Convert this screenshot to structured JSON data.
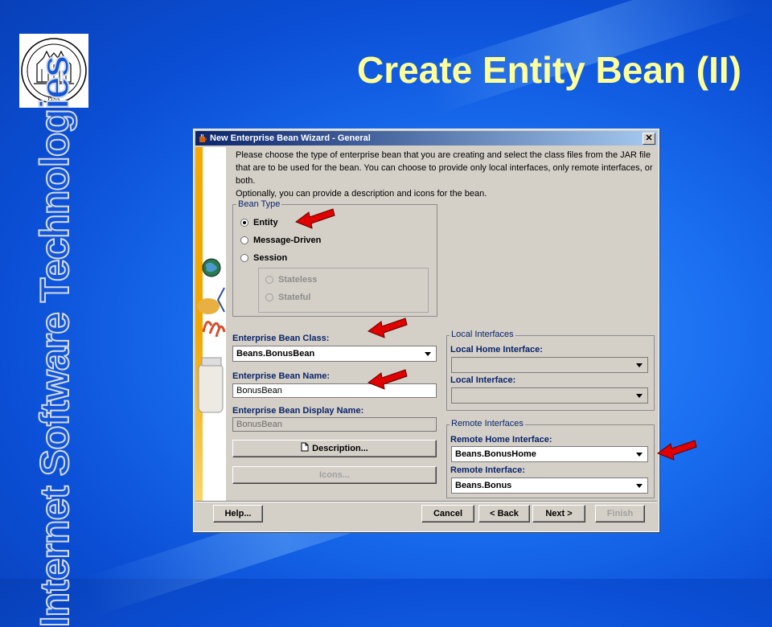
{
  "slide": {
    "title": "Create Entity Bean (II)",
    "side_title": "Internet Software Technologies",
    "seal_text": "PISA"
  },
  "dialog": {
    "title": "New Enterprise Bean Wizard - General",
    "close": "✕",
    "instructions": [
      "Please choose the type of enterprise bean that you are creating and select the class files from the JAR file",
      "that are to be used for the bean.  You can choose to provide only local interfaces, only remote interfaces, or",
      "both.",
      "Optionally, you can provide a description and icons for the bean."
    ],
    "bean_type": {
      "label": "Bean Type",
      "entity": "Entity",
      "message_driven": "Message-Driven",
      "session": "Session",
      "stateless": "Stateless",
      "stateful": "Stateful"
    },
    "bean_class": {
      "label": "Enterprise Bean Class:",
      "value": "Beans.BonusBean"
    },
    "bean_name": {
      "label": "Enterprise Bean Name:",
      "value": "BonusBean"
    },
    "display_name": {
      "label": "Enterprise Bean Display Name:",
      "value": "BonusBean"
    },
    "description_button": "Description...",
    "icons_button": "Icons...",
    "local": {
      "label": "Local Interfaces",
      "home_label": "Local Home Interface:",
      "home_value": "",
      "iface_label": "Local Interface:",
      "iface_value": ""
    },
    "remote": {
      "label": "Remote Interfaces",
      "home_label": "Remote Home Interface:",
      "home_value": "Beans.BonusHome",
      "iface_label": "Remote Interface:",
      "iface_value": "Beans.Bonus"
    },
    "buttons": {
      "help": "Help...",
      "cancel": "Cancel",
      "back": "< Back",
      "next": "Next >",
      "finish": "Finish"
    }
  },
  "colors": {
    "title": "#ffff99",
    "background": "#1a6ef0",
    "arrow": "#e00000",
    "label_blue": "#0a246a"
  }
}
